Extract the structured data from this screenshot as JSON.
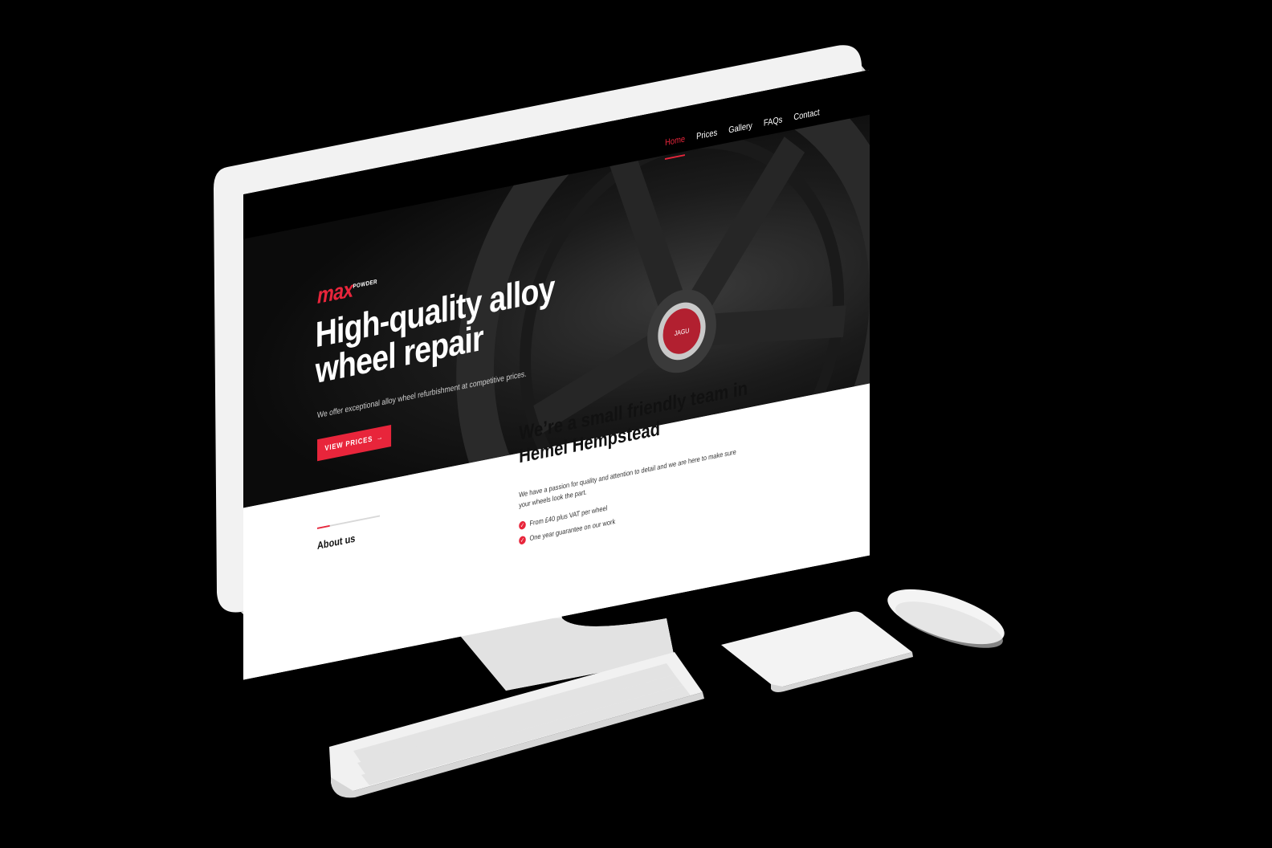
{
  "brand": {
    "logo_main": "max",
    "logo_sub": "POWDER",
    "accent": "#e8253b"
  },
  "nav": {
    "items": [
      {
        "label": "Home",
        "active": true
      },
      {
        "label": "Prices",
        "active": false
      },
      {
        "label": "Gallery",
        "active": false
      },
      {
        "label": "FAQs",
        "active": false
      },
      {
        "label": "Contact",
        "active": false
      }
    ]
  },
  "hero": {
    "title": "High-quality alloy wheel repair",
    "subtitle": "We offer exceptional alloy wheel refurbishment at competitive prices.",
    "cta_label": "VIEW PRICES",
    "cta_icon": "arrow-right-icon",
    "badge_text": "JAGU"
  },
  "about": {
    "label": "About us",
    "title": "We’re a small friendly team in Hemel Hempstead",
    "text": "We have a passion for quality and attention to detail and we are here to make sure your wheels look the part.",
    "checks": [
      "From £40 plus VAT per wheel",
      "One year guarantee on our work"
    ],
    "check_icon": "check-circle-icon"
  }
}
